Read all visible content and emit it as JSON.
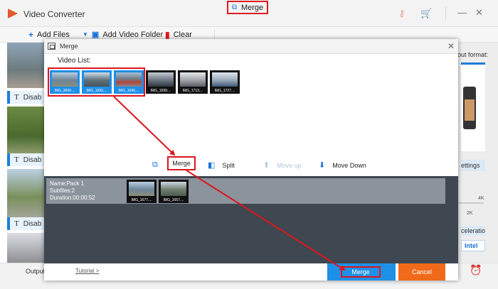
{
  "app": {
    "title": "Video Converter"
  },
  "toolbar": {
    "add_files": "Add Files",
    "add_video_folder": "Add Video Folder",
    "clear": "Clear",
    "merge": "Merge"
  },
  "file_list": {
    "rows": [
      {
        "subtitle_label": "Disab"
      },
      {
        "subtitle_label": "Disab"
      },
      {
        "subtitle_label": "Disab"
      }
    ]
  },
  "right_panel": {
    "output_format_label": "out format:",
    "settings_label": "ettings",
    "slider_max": "4K",
    "slider_mid": "2K",
    "acceleration_label": "celeration",
    "intel_label": "Intel"
  },
  "bottom_bar": {
    "output_label": "Output f"
  },
  "dialog": {
    "title": "Merge",
    "video_list_label": "Video List:",
    "videos": [
      {
        "name": "IMG_3660....",
        "selected": true
      },
      {
        "name": "IMG_1693....",
        "selected": true
      },
      {
        "name": "IMG_1696....",
        "selected": true
      },
      {
        "name": "IMG_1699....",
        "selected": false
      },
      {
        "name": "IMG_1713....",
        "selected": false
      },
      {
        "name": "IMG_1727....",
        "selected": false
      }
    ],
    "actions": {
      "merge": "Merge",
      "split": "Split",
      "move_up": "Move up",
      "move_down": "Move Down"
    },
    "pack": {
      "name": "Name:Pack 1",
      "subfiles": "Subfiles:2",
      "duration": "Duration:00:00:52",
      "clips": [
        {
          "name": "IMG_1677...."
        },
        {
          "name": "IMG_1657...."
        }
      ]
    },
    "footer": {
      "tutorial": "Tutorial >",
      "merge": "Merge",
      "cancel": "Cancel"
    }
  },
  "colors": {
    "accent": "#1e90e8",
    "cancel": "#f06a1a",
    "highlight": "#d9171e",
    "pack_bg": "#3f4750"
  }
}
